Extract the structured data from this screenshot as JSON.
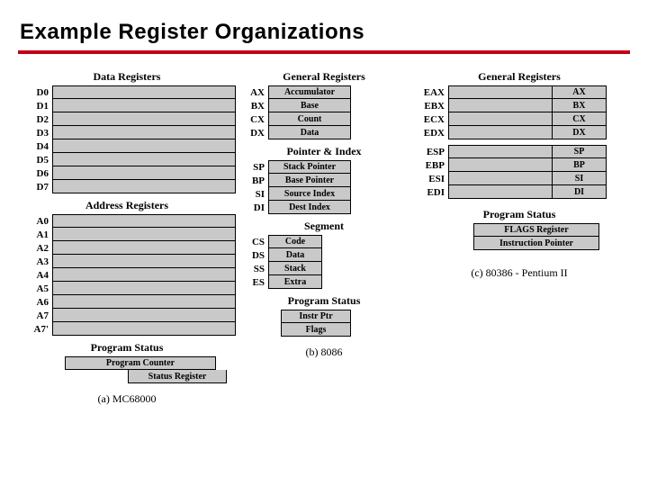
{
  "title": "Example Register Organizations",
  "colA": {
    "data_title": "Data Registers",
    "data": [
      "D0",
      "D1",
      "D2",
      "D3",
      "D4",
      "D5",
      "D6",
      "D7"
    ],
    "addr_title": "Address Registers",
    "addr": [
      "A0",
      "A1",
      "A2",
      "A3",
      "A4",
      "A5",
      "A6",
      "A7",
      "A7'"
    ],
    "ps_title": "Program Status",
    "pc": "Program Counter",
    "sr": "Status Register",
    "caption": "(a) MC68000"
  },
  "colB": {
    "gen_title": "General Registers",
    "gen": [
      {
        "lbl": "AX",
        "name": "Accumulator"
      },
      {
        "lbl": "BX",
        "name": "Base"
      },
      {
        "lbl": "CX",
        "name": "Count"
      },
      {
        "lbl": "DX",
        "name": "Data"
      }
    ],
    "pi_title": "Pointer & Index",
    "pi": [
      {
        "lbl": "SP",
        "name": "Stack Pointer"
      },
      {
        "lbl": "BP",
        "name": "Base Pointer"
      },
      {
        "lbl": "SI",
        "name": "Source Index"
      },
      {
        "lbl": "DI",
        "name": "Dest Index"
      }
    ],
    "seg_title": "Segment",
    "seg": [
      {
        "lbl": "CS",
        "name": "Code"
      },
      {
        "lbl": "DS",
        "name": "Data"
      },
      {
        "lbl": "SS",
        "name": "Stack"
      },
      {
        "lbl": "ES",
        "name": "Extra"
      }
    ],
    "ps_title": "Program Status",
    "ps": [
      "Instr Ptr",
      "Flags"
    ],
    "caption": "(b) 8086"
  },
  "colC": {
    "gen_title": "General Registers",
    "gen": [
      {
        "lbl": "EAX",
        "r": "AX"
      },
      {
        "lbl": "EBX",
        "r": "BX"
      },
      {
        "lbl": "ECX",
        "r": "CX"
      },
      {
        "lbl": "EDX",
        "r": "DX"
      }
    ],
    "ptr": [
      {
        "lbl": "ESP",
        "r": "SP"
      },
      {
        "lbl": "EBP",
        "r": "BP"
      },
      {
        "lbl": "ESI",
        "r": "SI"
      },
      {
        "lbl": "EDI",
        "r": "DI"
      }
    ],
    "ps_title": "Program Status",
    "ps": [
      "FLAGS Register",
      "Instruction Pointer"
    ],
    "caption": "(c) 80386 - Pentium II"
  }
}
